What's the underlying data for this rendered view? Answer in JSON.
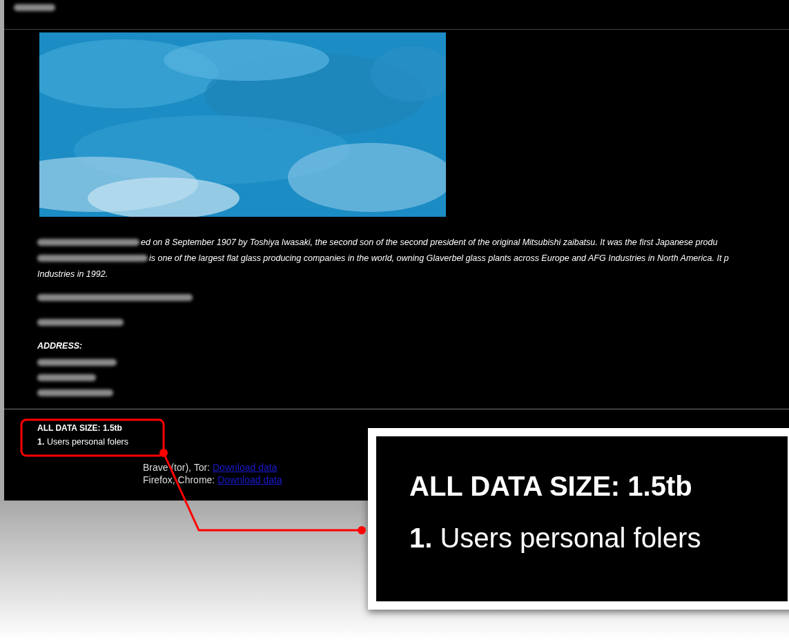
{
  "description": {
    "lines": [
      {
        "redacted": true,
        "text": "ed on 8 September 1907 by Toshiya Iwasaki, the second son of the second president of the original Mitsubishi zaibatsu. It was the first Japanese produ"
      },
      {
        "redacted": true,
        "text": "is one of the largest flat glass producing companies in the world, owning Glaverbel glass plants across Europe and AFG Industries in North America. It p"
      },
      {
        "redacted": false,
        "text": "Industries in 1992."
      }
    ]
  },
  "address_label": "ADDRESS:",
  "data_size": "ALL DATA SIZE: 1.5tb",
  "list_items": [
    {
      "number": "1.",
      "text": "Users personal folers"
    }
  ],
  "downloads": [
    {
      "label": "Brave (tor), Tor:",
      "link": "Download data"
    },
    {
      "label": "Firefox, Chrome:",
      "link": "Download data"
    }
  ],
  "callout": {
    "title": "ALL DATA SIZE: 1.5tb",
    "item_number": "1.",
    "item_text": "Users personal folers"
  }
}
